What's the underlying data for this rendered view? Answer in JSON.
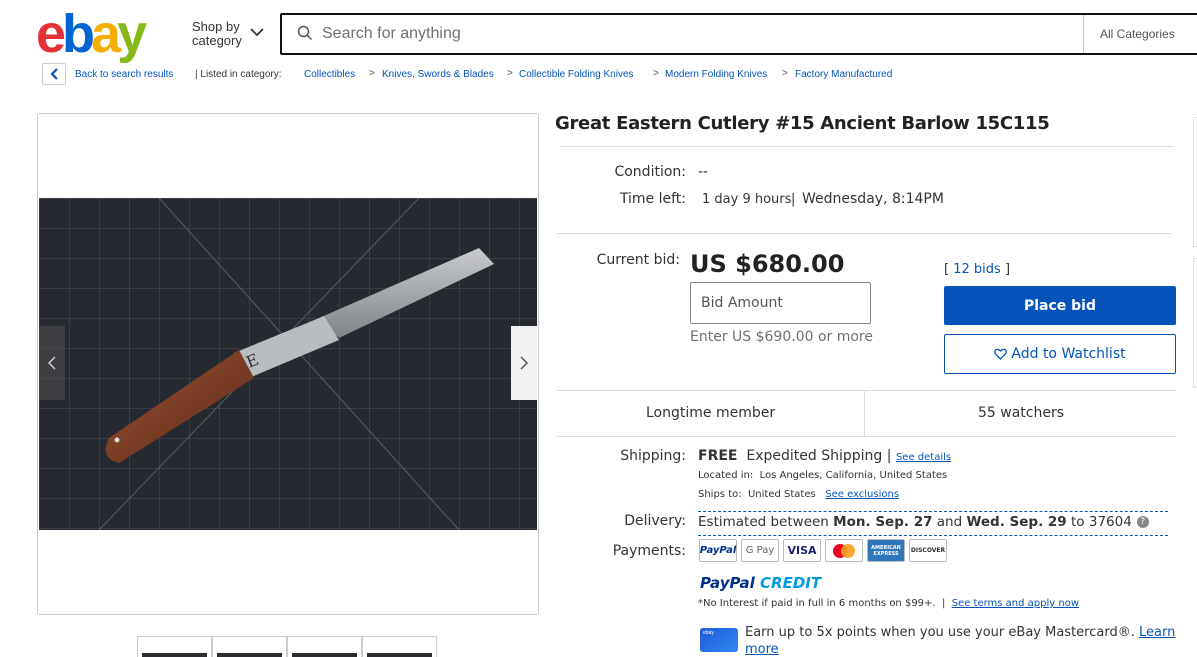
{
  "header": {
    "logo_letters": [
      "e",
      "b",
      "a",
      "y"
    ],
    "shop_by_line1": "Shop by",
    "shop_by_line2": "category",
    "search_placeholder": "Search for anything",
    "all_categories": "All Categories"
  },
  "breadcrumb": {
    "back": "Back to search results",
    "listed_in": "| Listed in category:",
    "items": [
      "Collectibles",
      "Knives, Swords & Blades",
      "Collectible Folding Knives",
      "Modern Folding Knives",
      "Factory Manufactured"
    ],
    "separator": ">"
  },
  "item": {
    "title": "Great Eastern Cutlery #15 Ancient Barlow 15C115",
    "condition_label": "Condition:",
    "condition_value": "--",
    "time_left_label": "Time left:",
    "time_left_value": "1 day 9 hours",
    "time_sep": "|",
    "end_time": "Wednesday, 8:14PM",
    "current_bid_label": "Current bid:",
    "current_bid": "US $680.00",
    "bid_placeholder": "Bid Amount",
    "bid_hint": "Enter US $690.00 or more",
    "bids_open": "[",
    "bids_count": "12 bids",
    "bids_close": "]",
    "place_bid": "Place bid",
    "watchlist": "Add to Watchlist",
    "seller_note": "Longtime member",
    "watchers": "55 watchers"
  },
  "shipping": {
    "label": "Shipping:",
    "free": "FREE",
    "method": "Expedited Shipping",
    "sep": "|",
    "see_details": "See details",
    "located_label": "Located in:",
    "located_value": "Los Angeles, California, United States",
    "ships_label": "Ships to:",
    "ships_value": "United States",
    "see_exclusions": "See exclusions"
  },
  "delivery": {
    "label": "Delivery:",
    "prefix": "Estimated between",
    "date1": "Mon. Sep. 27",
    "and": "and",
    "date2": "Wed. Sep. 29",
    "to": "to",
    "zip": "37604",
    "help": "?"
  },
  "payments": {
    "label": "Payments:",
    "methods": [
      "PayPal",
      "G Pay",
      "VISA",
      "Mastercard",
      "AMERICAN EXPRESS",
      "DISCOVER"
    ],
    "paypal_credit_1": "PayPal",
    "paypal_credit_2": "CREDIT",
    "credit_note": "*No Interest if paid in full in 6 months on $99+.",
    "credit_sep": "|",
    "credit_terms": "See terms and apply now",
    "card_tag": "ebay",
    "mastercard_promo": "Earn up to 5x points when you use your eBay Mastercard®.",
    "learn": "Learn",
    "more": "more"
  },
  "colors": {
    "ebay_red": "#e53238",
    "ebay_blue": "#0064d2",
    "ebay_yellow": "#f5af02",
    "ebay_green": "#86b817",
    "link": "#0654ba",
    "primary_button": "#0654ba"
  }
}
